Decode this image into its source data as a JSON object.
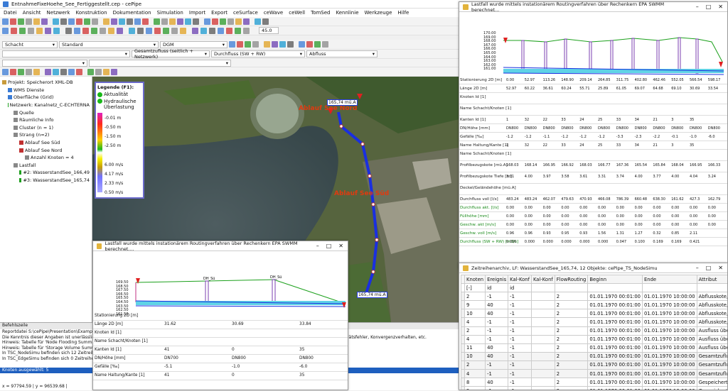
{
  "app": {
    "title": "EntnahmeFixeHoehe_See_Fertiggestellt.cep - cePipe"
  },
  "menu": [
    "Datei",
    "Ansicht",
    "Netzwerk",
    "Konstruktion",
    "Dokumentation",
    "Simulation",
    "Import",
    "Export",
    "ceSurface",
    "ceWave",
    "ceWell",
    "TomSed",
    "Kennlinie",
    "Werkzeuge",
    "Hilfe"
  ],
  "toolbar": {
    "angle": "45.0",
    "object_type": "Schacht",
    "standard": "Standard",
    "dgm": "DGM",
    "total_flow": "Gesamtzufluss (seitlich + Netzwerk)",
    "flow": "Durchfluss (SW + RW)",
    "outflow": "Abfluss"
  },
  "tree": {
    "items": [
      {
        "label": "Projekt: Speicherort XML-DB",
        "level": 0
      },
      {
        "label": "WMS Dienste",
        "level": 1
      },
      {
        "label": "Oberfläche (Grid)",
        "level": 1
      },
      {
        "label": "Netzwerk: Kanalnetz_C-ECHTERNA",
        "level": 1
      },
      {
        "label": "Quelle",
        "level": 2
      },
      {
        "label": "Räumliche Info",
        "level": 2
      },
      {
        "label": "Cluster (n = 1)",
        "level": 2
      },
      {
        "label": "Strang (n=2)",
        "level": 2
      },
      {
        "label": "Ablauf See Süd",
        "level": 3
      },
      {
        "label": "Ablauf See Nord",
        "level": 3
      },
      {
        "label": "Anzahl Knoten = 4",
        "level": 4
      },
      {
        "label": "Lastfall",
        "level": 2
      },
      {
        "label": "#2: WasserstandSee_166,49",
        "level": 3
      },
      {
        "label": "#3: WasserstandSee_165,74",
        "level": 3
      }
    ]
  },
  "legend": {
    "title": "Legende (F1):",
    "current": "Aktualität",
    "hydraulic": "Hydraulische Überlastung",
    "levels": [
      "-0.01 m",
      "-0.50 m",
      "-1.50 m",
      "-2.50 m"
    ],
    "speeds": [
      "6.00 m/s",
      "4.17 m/s",
      "2.33 m/s",
      "0.50 m/s"
    ]
  },
  "map": {
    "labels": {
      "nord": "Ablauf See Nord",
      "sued": "Ablauf See Süd",
      "v1": "165,74 mü.A",
      "v2": "165,74 mü.A"
    }
  },
  "messages": {
    "header": "Befehlszeile",
    "lines": [
      "Reportdatei S:\\cePipe\\Presentation\\Example\\_Bei",
      "Die Kenntnis dieser Angaben ist unerlässlich für die",
      "Hinweis: Tabelle für 'Node Flooding Summary' kon",
      "Hinweis: Tabelle für 'Storage Volume Summary' kon",
      "In TSC_NodeSimu befinden sich 12 Zeitreihen",
      "In TSC_EdgeSimu befinden sich 0 Zeitreihen"
    ],
    "extra": "lätsfehler, Konvergenzverhalten, etc.",
    "status": "Knoten ausgewählt: 5",
    "coords": "x = 97794.59 | y = 96539.68 |"
  },
  "profile_small": {
    "title": "Lastfall wurde mittels instationärem Routingverfahren über Rechenkern EPA SWMM berechnet....",
    "yticks": [
      "169.50",
      "168.50",
      "167.50",
      "166.50",
      "165.50",
      "164.50",
      "163.50",
      "162.50",
      "161.50"
    ],
    "station_label": "Stationierung 2D [m]",
    "length_label": "Länge 2D [m]",
    "lengths": [
      "31.62",
      "30.69",
      "33.84"
    ],
    "node_label": "Knoten Id [1]",
    "name_label": "Name Schacht/Knoten [1]",
    "edge_label": "Kanten Id [1]",
    "edges": [
      "41",
      "0",
      "35"
    ],
    "dn_label": "DN/Höhe [mm]",
    "dns": [
      "DN700",
      "DN800",
      "DN800"
    ],
    "slope_label": "Gefälle [‰]",
    "slopes": [
      "-5.1",
      "-1.0",
      "-6.0"
    ],
    "haltung_label": "Name Haltung/Kante [1]",
    "haltungen": [
      "41",
      "0",
      "35"
    ]
  },
  "profile_large": {
    "title": "Lastfall wurde mittels instationärem Routingverfahren über Rechenkern EPA SWMM berechnet...",
    "yticks": [
      "170.00",
      "169.00",
      "168.00",
      "167.00",
      "166.00",
      "165.00",
      "164.00",
      "163.00",
      "162.00",
      "161.00"
    ],
    "rows": [
      {
        "label": "Stationierung 2D [m]",
        "values": [
          "0.00",
          "52.97",
          "113.26",
          "148.90",
          "209.14",
          "264.85",
          "311.75",
          "402.80",
          "462.46",
          "552.05",
          "566.54",
          "598.17"
        ]
      },
      {
        "label": "Länge 2D [m]",
        "values": [
          "52.97",
          "60.22",
          "36.61",
          "60.24",
          "55.71",
          "25.89",
          "61.05",
          "69.07",
          "64.68",
          "69.10",
          "30.69",
          "33.54"
        ]
      },
      {
        "label": "Knoten Id [1]",
        "values": [
          "",
          "",
          "",
          "",
          "",
          "",
          "",
          "",
          "",
          "",
          "",
          ""
        ]
      },
      {
        "label": "Name Schacht/Knoten [1]",
        "values": [
          "",
          "",
          "",
          "",
          "",
          "",
          "",
          "",
          "",
          "",
          "",
          ""
        ]
      },
      {
        "label": "Kanten Id [1]",
        "values": [
          "1",
          "32",
          "22",
          "33",
          "24",
          "25",
          "33",
          "34",
          "21",
          "3",
          "35",
          ""
        ]
      },
      {
        "label": "DN/Höhe [mm]",
        "values": [
          "DN800",
          "DN800",
          "DN800",
          "DN800",
          "DN800",
          "DN800",
          "DN800",
          "DN800",
          "DN800",
          "DN800",
          "DN800",
          "DN800"
        ]
      },
      {
        "label": "Gefälle [‰]",
        "values": [
          "-1.2",
          "-1.2",
          "-1.1",
          "-1.2",
          "-1.2",
          "-1.2",
          "-3.3",
          "-2.3",
          "-2.2",
          "-0.1",
          "-1.0",
          "-6.0"
        ]
      },
      {
        "label": "Name Haltung/Kante [1]",
        "values": [
          "1",
          "32",
          "22",
          "33",
          "24",
          "25",
          "33",
          "34",
          "21",
          "3",
          "35",
          ""
        ]
      },
      {
        "label": "Name Schacht/Knoten [1]",
        "values": [
          "",
          "",
          "",
          "",
          "",
          "",
          "",
          "",
          "",
          "",
          "",
          ""
        ]
      },
      {
        "label": "Profilbezugskote [mü.A]",
        "values": [
          "168.03",
          "168.14",
          "166.95",
          "166.92",
          "168.03",
          "166.77",
          "167.36",
          "165.54",
          "165.84",
          "168.04",
          "166.95",
          "166.33"
        ]
      },
      {
        "label": "Profilbezugskote Tiefe [m]",
        "values": [
          "3.31",
          "4.00",
          "3.97",
          "3.58",
          "3.61",
          "3.31",
          "3.74",
          "4.00",
          "3.77",
          "4.00",
          "4.04",
          "3.24"
        ]
      },
      {
        "label": "Deckel/Geländehöhe [mü.A]",
        "values": [
          "",
          "",
          "",
          "",
          "",
          "",
          "",
          "",
          "",
          "",
          "",
          ""
        ]
      },
      {
        "label": "Durchfluss voll [l/s]",
        "values": [
          "483.24",
          "483.24",
          "462.07",
          "479.63",
          "470.93",
          "466.08",
          "786.39",
          "660.48",
          "638.30",
          "161.62",
          "427.3",
          "162.79"
        ]
      },
      {
        "label": "Durchfluss akt. [l/s]",
        "values": [
          "0.00",
          "0.00",
          "0.00",
          "0.00",
          "0.00",
          "0.00",
          "0.00",
          "0.00",
          "0.00",
          "0.00",
          "0.00",
          "0.00"
        ]
      },
      {
        "label": "Füllhöhe [mm]",
        "values": [
          "0.00",
          "0.00",
          "0.00",
          "0.00",
          "0.00",
          "0.00",
          "0.00",
          "0.00",
          "0.00",
          "0.00",
          "0.00",
          "0.00"
        ]
      },
      {
        "label": "Geschw. akt [m/s]",
        "values": [
          "0.00",
          "0.00",
          "0.00",
          "0.00",
          "0.00",
          "0.00",
          "0.00",
          "0.00",
          "0.00",
          "0.00",
          "0.00",
          "0.00"
        ]
      },
      {
        "label": "Geschw. voll [m/s]",
        "values": [
          "0.96",
          "0.96",
          "0.93",
          "0.95",
          "0.93",
          "1.56",
          "1.31",
          "1.27",
          "0.32",
          "0.85",
          "2.11",
          ""
        ]
      },
      {
        "label": "Durchfluss (SW + RW) [m3/s]",
        "values": [
          "0.000",
          "0.000",
          "0.000",
          "0.000",
          "0.000",
          "0.000",
          "0.047",
          "0.100",
          "0.169",
          "0.169",
          "0.421",
          ""
        ]
      }
    ]
  },
  "timeseries": {
    "title": "Zeitreihenarchiv, LF: WasserstandSee_165,74, 12 Objekte: cePipe_TS_NodeSimu",
    "columns": [
      "Knoten",
      "Ereignis",
      "Kal-Konf",
      "Kal-Konf",
      "FlowRouting",
      "Beginn",
      "Ende",
      "Attribut"
    ],
    "subhead": [
      "[-]",
      "id",
      "id",
      "",
      "",
      "",
      "",
      ""
    ],
    "rows": [
      [
        "2",
        "-1",
        "-1",
        "",
        "2",
        "01.01.1970 00:01:00",
        "01.01.1970 10:00:00",
        "Abflusskote, Druckhöhe"
      ],
      [
        "9",
        "40",
        "-1",
        "",
        "2",
        "01.01.1970 00:01:00",
        "01.01.1970 10:00:00",
        "Abflusskote, Druckhöhe"
      ],
      [
        "10",
        "40",
        "-1",
        "",
        "2",
        "01.01.1970 00:01:00",
        "01.01.1970 10:00:00",
        "Abflusskote, Druckhöhe"
      ],
      [
        "4",
        "-1",
        "-1",
        "",
        "2",
        "01.01.1970 00:01:00",
        "01.01.1970 10:00:00",
        "Abflusskote, Druckhöhe"
      ],
      [
        "2",
        "-1",
        "-1",
        "",
        "2",
        "01.01.1970 00:01:00",
        "01.01.1970 10:00:00",
        "Ausfluss über Schacht"
      ],
      [
        "4",
        "-1",
        "-1",
        "",
        "2",
        "01.01.1970 00:01:00",
        "01.01.1970 10:00:00",
        "Ausfluss über Schacht"
      ],
      [
        "11",
        "40",
        "-1",
        "",
        "2",
        "01.01.1970 00:01:00",
        "01.01.1970 10:00:00",
        "Ausfluss über Schacht"
      ],
      [
        "10",
        "40",
        "-1",
        "",
        "2",
        "01.01.1970 00:01:00",
        "01.01.1970 10:00:00",
        "Gesamtzufluss (seitlich + Ne"
      ],
      [
        "2",
        "-1",
        "-1",
        "",
        "2",
        "01.01.1970 00:01:00",
        "01.01.1970 10:00:00",
        "Gesamtzufluss (seitlich + Ne"
      ],
      [
        "4",
        "-1",
        "-1",
        "",
        "2",
        "01.01.1970 00:01:00",
        "01.01.1970 10:00:00",
        "Gesamtzufluss (seitlich + Ne"
      ],
      [
        "8",
        "40",
        "-1",
        "",
        "2",
        "01.01.1970 00:01:00",
        "01.01.1970 10:00:00",
        "Gespeichertes Vol (auch übe"
      ],
      [
        "2",
        "-1",
        "-1",
        "",
        "2",
        "01.01.1970 00:01:00",
        "01.01.1970 10:00:00",
        "Gespeichertes Vol (auch übe"
      ]
    ]
  },
  "colors": {
    "accent": "#1e5fbf",
    "pipe": "#1a2fe0",
    "ground": "#3aa33a",
    "water": "#5fd3e6",
    "legend_border": "#6a6aca"
  }
}
